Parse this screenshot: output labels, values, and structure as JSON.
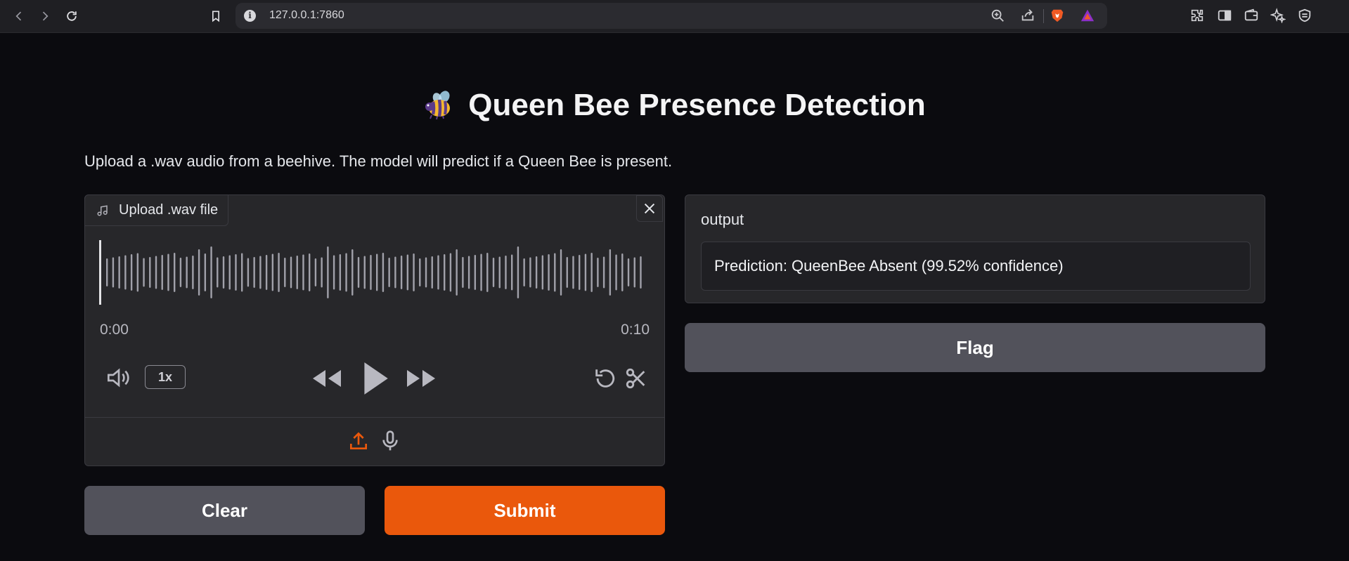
{
  "browser": {
    "url": "127.0.0.1:7860"
  },
  "app": {
    "title": "Queen Bee Presence Detection",
    "description": "Upload a .wav audio from a beehive. The model will predict if a Queen Bee is present."
  },
  "audio_input": {
    "label": "Upload .wav file",
    "time_current": "0:00",
    "time_total": "0:10",
    "playback_speed": "1x",
    "progress": 0.0
  },
  "output": {
    "label": "output",
    "value": "Prediction: QueenBee Absent (99.52% confidence)"
  },
  "buttons": {
    "flag": "Flag",
    "clear": "Clear",
    "submit": "Submit"
  },
  "colors": {
    "accent": "#ea580c",
    "secondary_button": "#52525b",
    "panel": "#27272a",
    "background": "#0b0b0f"
  },
  "icons": [
    "back-icon",
    "forward-icon",
    "reload-icon",
    "bookmark-icon",
    "info-icon",
    "zoom-icon",
    "share-icon",
    "brave-icon",
    "rewards-icon",
    "extensions-icon",
    "sidebar-icon",
    "wallet-icon",
    "leo-icon",
    "vpn-icon",
    "bee-icon",
    "music-note-icon",
    "close-icon",
    "volume-icon",
    "rewind-icon",
    "play-icon",
    "fast-forward-icon",
    "undo-icon",
    "scissors-icon",
    "upload-icon",
    "microphone-icon"
  ]
}
